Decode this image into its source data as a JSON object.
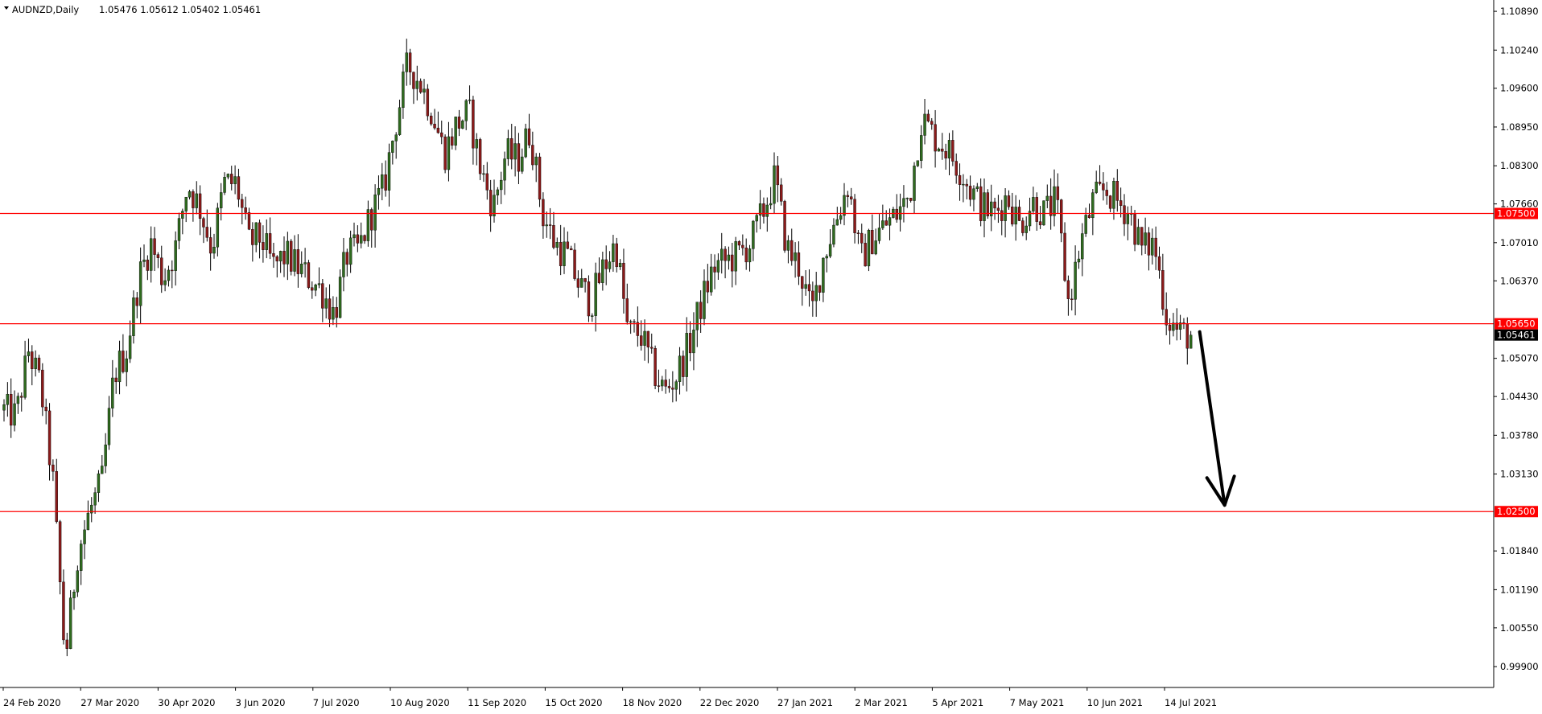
{
  "header": {
    "symbol_timeframe": "AUDNZD,Daily",
    "ohlc": "1.05476 1.05612 1.05402 1.05461"
  },
  "chart_data": {
    "type": "candlestick",
    "symbol": "AUDNZD",
    "timeframe": "Daily",
    "ylim": [
      0.9955,
      1.1108
    ],
    "y_ticks": [
      "1.10890",
      "1.10240",
      "1.09600",
      "1.08950",
      "1.08300",
      "1.07660",
      "1.07010",
      "1.06370",
      "1.05070",
      "1.04430",
      "1.03780",
      "1.03130",
      "1.01840",
      "1.01190",
      "1.00550",
      "0.99900"
    ],
    "x_ticks": [
      "24 Feb 2020",
      "27 Mar 2020",
      "30 Apr 2020",
      "3 Jun 2020",
      "7 Jul 2020",
      "10 Aug 2020",
      "11 Sep 2020",
      "15 Oct 2020",
      "18 Nov 2020",
      "22 Dec 2020",
      "27 Jan 2021",
      "2 Mar 2021",
      "5 Apr 2021",
      "7 May 2021",
      "10 Jun 2021",
      "14 Jul 2021"
    ],
    "price_path": [
      1.042,
      1.041,
      1.052,
      1.046,
      1.03,
      1.0,
      1.018,
      1.025,
      1.03,
      1.048,
      1.052,
      1.064,
      1.07,
      1.064,
      1.069,
      1.08,
      1.076,
      1.069,
      1.08,
      1.08,
      1.07,
      1.071,
      1.066,
      1.068,
      1.066,
      1.064,
      1.062,
      1.058,
      1.068,
      1.069,
      1.075,
      1.079,
      1.09,
      1.1,
      1.097,
      1.092,
      1.085,
      1.09,
      1.092,
      1.082,
      1.076,
      1.085,
      1.084,
      1.089,
      1.075,
      1.07,
      1.068,
      1.063,
      1.06,
      1.066,
      1.07,
      1.055,
      1.055,
      1.049,
      1.045,
      1.048,
      1.053,
      1.06,
      1.066,
      1.067,
      1.068,
      1.07,
      1.075,
      1.081,
      1.069,
      1.066,
      1.058,
      1.068,
      1.074,
      1.08,
      1.067,
      1.071,
      1.073,
      1.075,
      1.078,
      1.091,
      1.088,
      1.086,
      1.083,
      1.079,
      1.076,
      1.075,
      1.078,
      1.073,
      1.077,
      1.075,
      1.077,
      1.06,
      1.07,
      1.077,
      1.079,
      1.077,
      1.075,
      1.069,
      1.07,
      1.058,
      1.055,
      1.0546
    ],
    "last_price": "1.05461",
    "horizontal_levels": [
      {
        "value": 1.075,
        "label": "1.07500"
      },
      {
        "value": 1.0565,
        "label": "1.05650"
      },
      {
        "value": 1.025,
        "label": "1.02500"
      }
    ],
    "colors": {
      "bull_body": "#2f6b1f",
      "bear_body": "#8b1a1a",
      "wick": "#000000",
      "level_line": "#ff0000",
      "last_price_bg": "#000000",
      "arrow": "#000000"
    },
    "projection_arrow": {
      "direction": "down",
      "target": 1.025
    }
  }
}
